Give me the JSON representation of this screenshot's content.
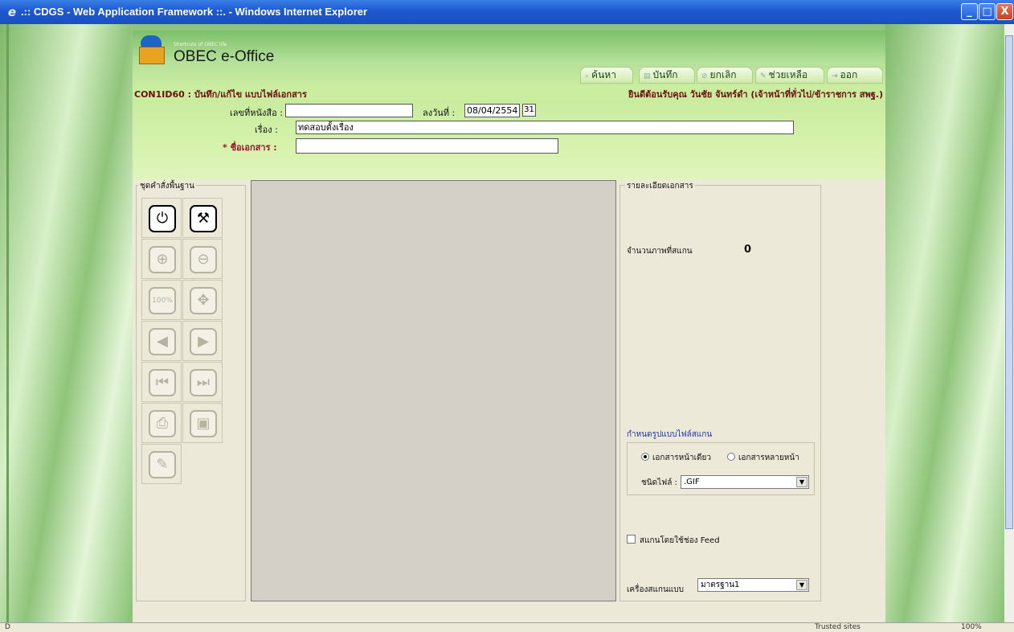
{
  "window": {
    "title": ".:: CDGS - Web Application Framework ::. - Windows Internet Explorer",
    "min": "_",
    "max": "□",
    "close": "X"
  },
  "header": {
    "tagline": "Shortcuts of OBEC life",
    "app_title": "OBEC e-Office",
    "buttons": {
      "search": "ค้นหา",
      "save": "บันทึก",
      "cancel": "ยกเลิก",
      "help": "ช่วยเหลือ",
      "exit": "ออก"
    }
  },
  "strip": {
    "form_code": "CON1ID60 : บันทึก/แก้ไข แบบไฟล์เอกสาร",
    "welcome": "ยินดีต้อนรับคุณ วันชัย จันทร์ดำ (เจ้าหน้าที่ทั่วไป/ข้าราชการ สพฐ.)"
  },
  "form": {
    "doc_no_label": "เลขที่หนังสือ :",
    "doc_no_value": "",
    "date_label": "ลงวันที่ :",
    "date_value": "08/04/2554",
    "cal_icon": "31",
    "subject_label": "เรื่อง :",
    "subject_value": "ทดสอบตั้งเรื่อง",
    "docname_label": "* ชื่อเอกสาร :",
    "docname_value": ""
  },
  "toolbox": {
    "legend": "ชุดคำสั่งพื้นฐาน",
    "tools": [
      {
        "icon": "power-icon",
        "glyph": "⏻"
      },
      {
        "icon": "tools-icon",
        "glyph": "⚒"
      },
      {
        "icon": "zoom-in-icon",
        "glyph": "⊕"
      },
      {
        "icon": "zoom-out-icon",
        "glyph": "⊖"
      },
      {
        "icon": "actual-size-icon",
        "glyph": "100%"
      },
      {
        "icon": "fit-page-icon",
        "glyph": "✥"
      },
      {
        "icon": "previous-page-icon",
        "glyph": "◀"
      },
      {
        "icon": "next-page-icon",
        "glyph": "▶"
      },
      {
        "icon": "first-page-icon",
        "glyph": "⏮"
      },
      {
        "icon": "last-page-icon",
        "glyph": "⏭"
      },
      {
        "icon": "print-icon",
        "glyph": "⎙"
      },
      {
        "icon": "save-disk-icon",
        "glyph": "▣"
      },
      {
        "icon": "pencil-icon",
        "glyph": "✎"
      }
    ]
  },
  "details": {
    "legend": "รายละเอียดเอกสาร",
    "scan_count_label": "จำนวนภาพที่สแกน",
    "scan_count_value": "0",
    "format_title": "กำหนดรูปแบบไฟล์สแกน",
    "radio_single": "เอกสารหน้าเดียว",
    "radio_multi": "เอกสารหลายหน้า",
    "filetype_label": "ชนิดไฟล์ :",
    "filetype_value": ".GIF",
    "feed_label": "สแกนโดยใช้ช่อง Feed",
    "scanner_label": "เครื่องสแกนแบบ",
    "scanner_value": "มาตรฐาน1"
  },
  "statusbar": {
    "left": "D",
    "zone": "Trusted sites",
    "zoom": "100%"
  }
}
